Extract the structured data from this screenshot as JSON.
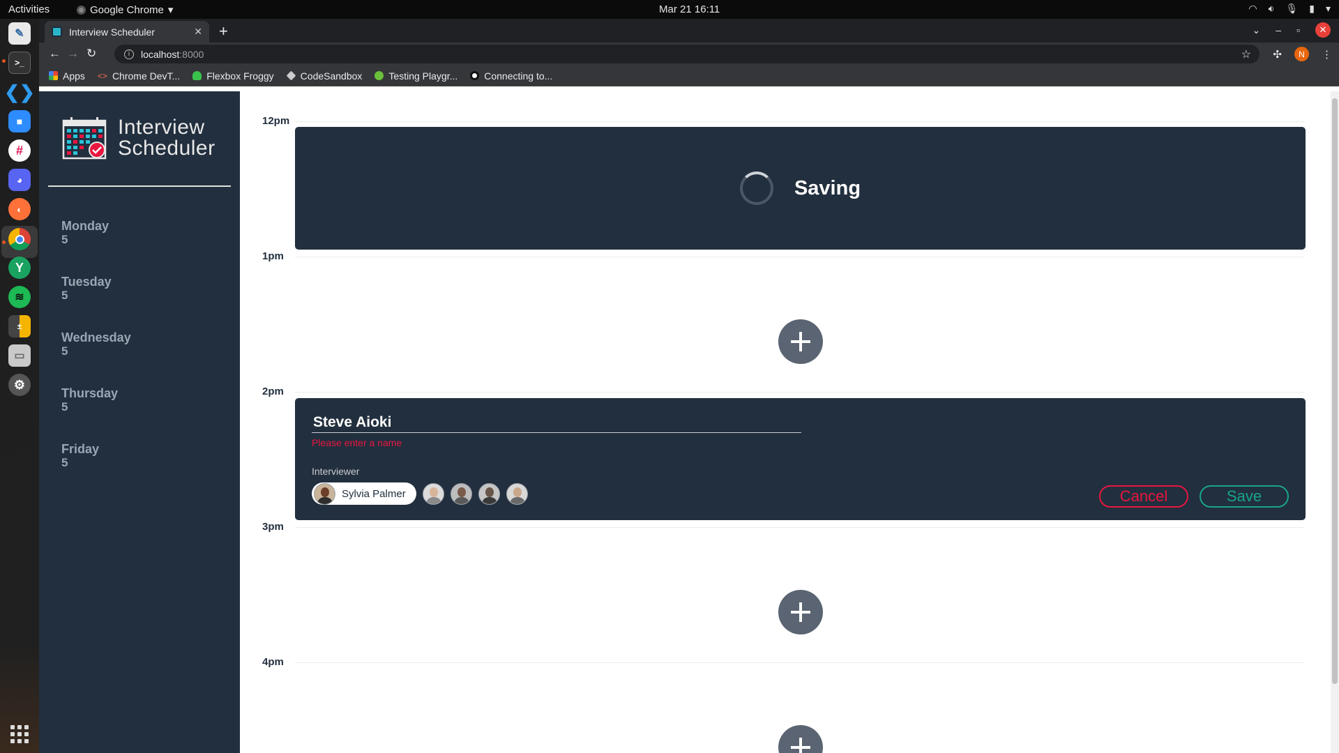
{
  "os": {
    "activities": "Activities",
    "app_name": "Google Chrome",
    "clock": "Mar 21  16:11",
    "tray": [
      "wifi-icon",
      "volume-icon",
      "mic-icon",
      "battery-icon",
      "chevron-down-icon"
    ]
  },
  "dock": {
    "apps": [
      "text-editor-icon",
      "terminal-icon",
      "vscode-icon",
      "zoom-icon",
      "slack-icon",
      "discord-icon",
      "firefox-icon",
      "chrome-icon",
      "yarn-icon",
      "spotify-icon",
      "calculator-icon",
      "files-icon",
      "settings-icon",
      "show-apps-icon"
    ],
    "active": "chrome-icon"
  },
  "browser": {
    "tab_title": "Interview Scheduler",
    "url_host": "localhost",
    "url_port": ":8000",
    "profile_initial": "N",
    "bookmarks": [
      "Apps",
      "Chrome DevT...",
      "Flexbox Froggy",
      "CodeSandbox",
      "Testing Playgr...",
      "Connecting to..."
    ]
  },
  "app": {
    "logo_line1": "Interview",
    "logo_line2": "Scheduler",
    "days": [
      {
        "name": "Monday",
        "spots": "5"
      },
      {
        "name": "Tuesday",
        "spots": "5"
      },
      {
        "name": "Wednesday",
        "spots": "5"
      },
      {
        "name": "Thursday",
        "spots": "5"
      },
      {
        "name": "Friday",
        "spots": "5"
      }
    ],
    "times": [
      "12pm",
      "1pm",
      "2pm",
      "3pm",
      "4pm"
    ],
    "saving_text": "Saving",
    "form": {
      "student_name": "Steve Aioki",
      "validation": "Please enter a name",
      "interviewer_label": "Interviewer",
      "selected_interviewer": "Sylvia Palmer",
      "cancel_label": "Cancel",
      "save_label": "Save"
    }
  },
  "colors": {
    "sidebar": "#222f3e",
    "card": "#222f3e",
    "danger": "#e8163f",
    "success": "#18a689",
    "add_button": "#5a6472"
  }
}
